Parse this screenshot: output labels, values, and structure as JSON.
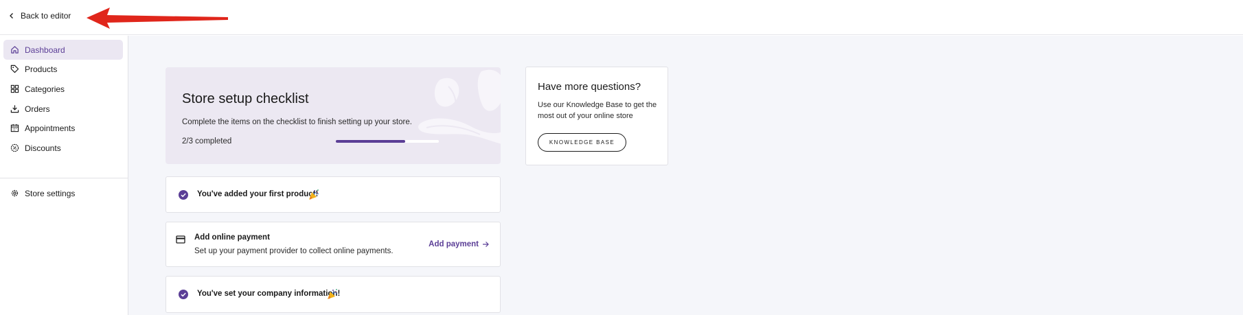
{
  "topbar": {
    "back_label": "Back to editor"
  },
  "sidebar": {
    "items": [
      {
        "label": "Dashboard",
        "icon": "home-icon",
        "active": true
      },
      {
        "label": "Products",
        "icon": "tag-icon"
      },
      {
        "label": "Categories",
        "icon": "grid-icon"
      },
      {
        "label": "Orders",
        "icon": "download-icon"
      },
      {
        "label": "Appointments",
        "icon": "calendar-icon"
      },
      {
        "label": "Discounts",
        "icon": "discount-badge-icon"
      },
      {
        "label": "Store settings",
        "icon": "gear-icon"
      }
    ]
  },
  "checklist": {
    "title": "Store setup checklist",
    "description": "Complete the items on the checklist to finish setting up your store.",
    "progress_text": "2/3 completed",
    "progress_fraction": 0.67
  },
  "tasks": [
    {
      "title": "You've added your first product!",
      "completed": true
    },
    {
      "title": "Add online payment",
      "subtitle": "Set up your payment provider to collect online payments.",
      "action_label": "Add payment",
      "completed": false,
      "icon": "credit-card-icon"
    },
    {
      "title": "You've set your company information!",
      "completed": true
    }
  ],
  "help": {
    "title": "Have more questions?",
    "description": "Use our Knowledge Base to get the most out of your online store",
    "button_label": "KNOWLEDGE BASE"
  },
  "colors": {
    "accent": "#5b3e96",
    "active_bg": "#ebe7f2",
    "checklist_bg": "#ece8f2",
    "main_bg": "#f5f6fa",
    "annotation_arrow": "#e0261b"
  }
}
